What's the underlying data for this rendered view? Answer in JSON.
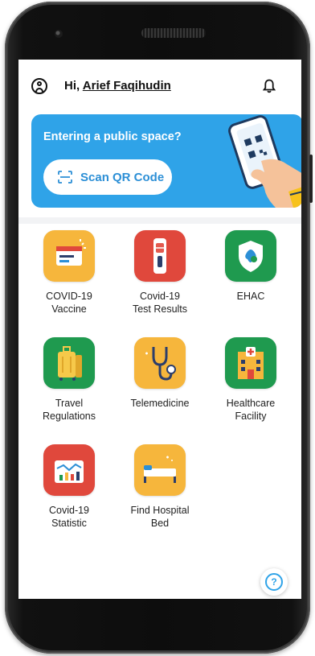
{
  "header": {
    "greeting_prefix": "Hi,",
    "user_name": "Arief Faqihudin"
  },
  "banner": {
    "title": "Entering a public space?",
    "scan_label": "Scan QR Code"
  },
  "menu": [
    {
      "name": "covid-vaccine",
      "line1": "COVID-19",
      "line2": "Vaccine",
      "icon": "vaccine-card-icon",
      "color": "#f6b63c"
    },
    {
      "name": "covid-test-results",
      "line1": "Covid-19",
      "line2": "Test Results",
      "icon": "test-kit-icon",
      "color": "#e0483c"
    },
    {
      "name": "ehac",
      "line1": "EHAC",
      "line2": "",
      "icon": "shield-icon",
      "color": "#1f9a4f"
    },
    {
      "name": "travel-regulations",
      "line1": "Travel",
      "line2": "Regulations",
      "icon": "luggage-icon",
      "color": "#1f9a4f"
    },
    {
      "name": "telemedicine",
      "line1": "Telemedicine",
      "line2": "",
      "icon": "stethoscope-icon",
      "color": "#f6b63c"
    },
    {
      "name": "healthcare-facility",
      "line1": "Healthcare",
      "line2": "Facility",
      "icon": "hospital-building-icon",
      "color": "#1f9a4f"
    },
    {
      "name": "covid-statistic",
      "line1": "Covid-19",
      "line2": "Statistic",
      "icon": "statistic-chart-icon",
      "color": "#e0483c"
    },
    {
      "name": "find-hospital-bed",
      "line1": "Find Hospital",
      "line2": "Bed",
      "icon": "hospital-bed-icon",
      "color": "#f6b63c"
    }
  ],
  "help_label": "?"
}
